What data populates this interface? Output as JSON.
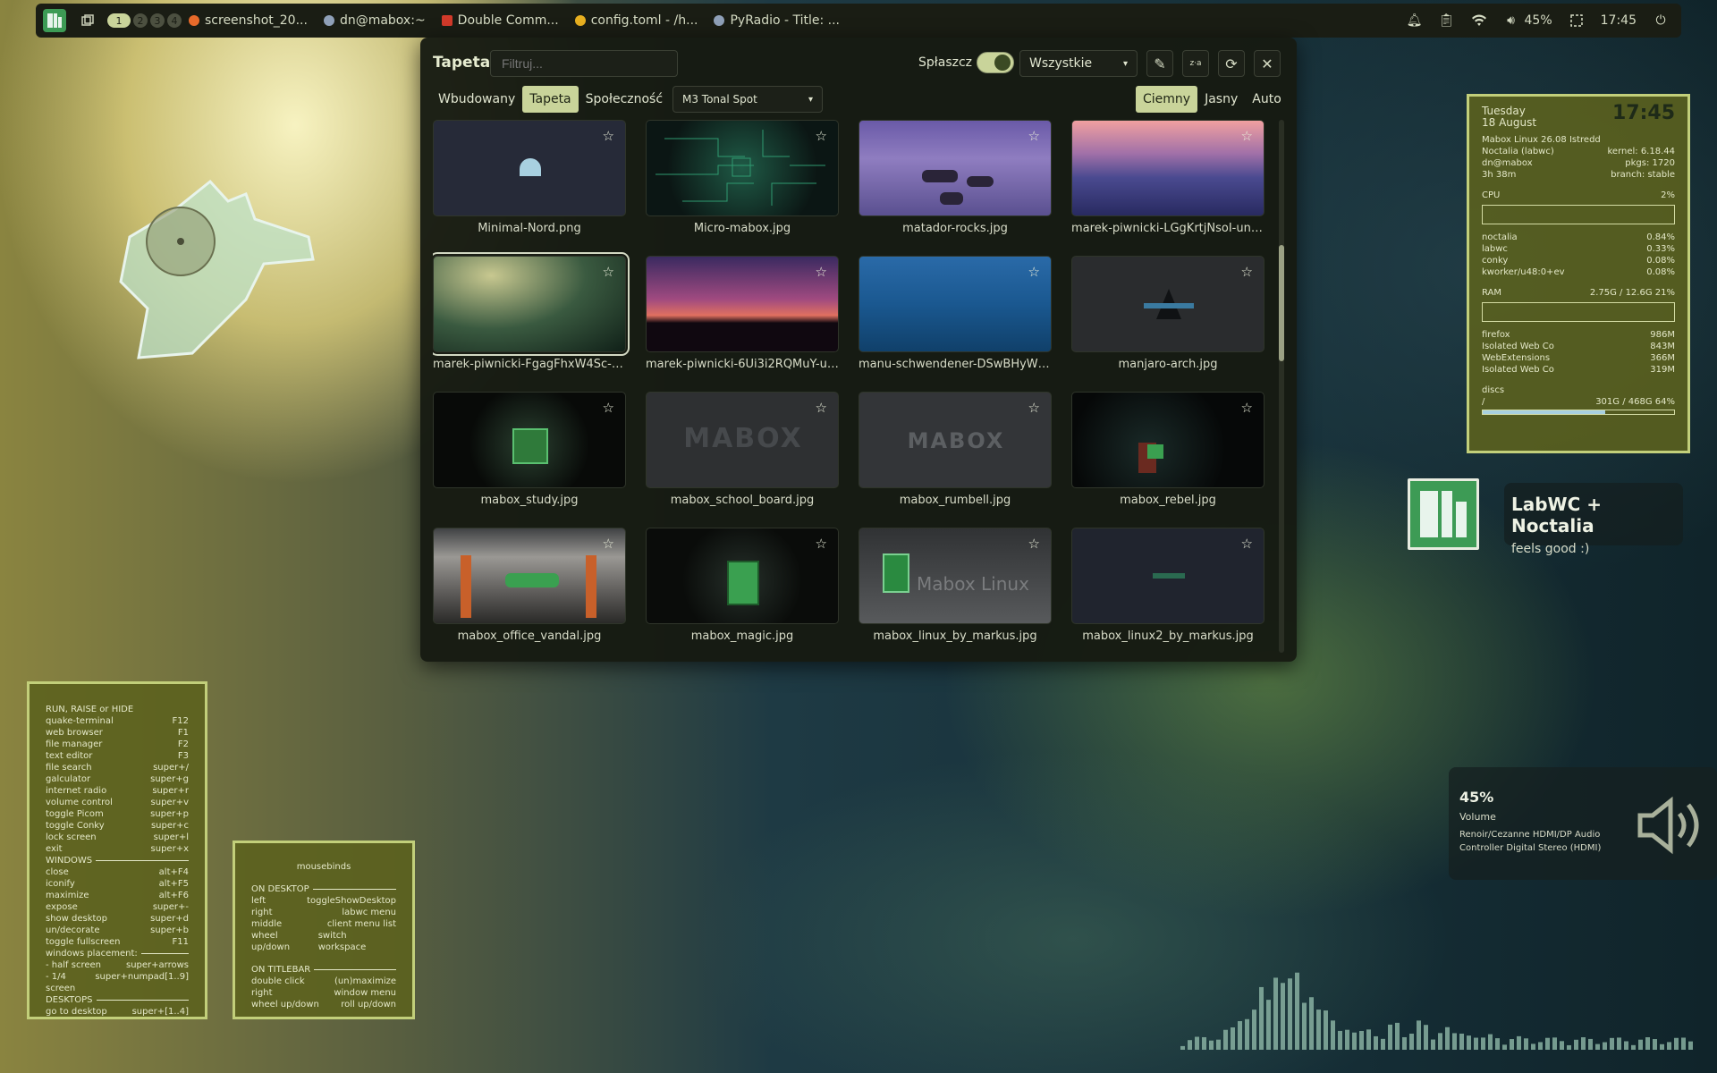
{
  "topbar": {
    "workspaces": [
      "1",
      "2",
      "3",
      "4"
    ],
    "tasks": [
      {
        "label": "screenshot_20...",
        "color": "#e86a2a",
        "icon": "firefox-icon"
      },
      {
        "label": "dn@mabox:~",
        "color": "#8fa0b8",
        "icon": "terminal-icon"
      },
      {
        "label": "Double Comm...",
        "color": "#d23a2a",
        "icon": "double-commander-icon"
      },
      {
        "label": "config.toml - /h...",
        "color": "#e8b020",
        "icon": "editor-icon"
      },
      {
        "label": "PyRadio - Title: ...",
        "color": "#8fa0b8",
        "icon": "radio-icon"
      }
    ],
    "volume": "45%",
    "time": "17:45"
  },
  "panel": {
    "title": "Tapeta",
    "filter_placeholder": "Filtruj...",
    "flatten_label": "Spłaszcz",
    "source_select": "Wszystkie",
    "tabs": [
      "Wbudowany",
      "Tapeta",
      "Społeczność"
    ],
    "active_tab": "Tapeta",
    "scheme_select": "M3 Tonal Spot",
    "modes": [
      "Ciemny",
      "Jasny",
      "Auto"
    ],
    "active_mode": "Ciemny",
    "items": [
      {
        "name": "Minimal-Nord.png"
      },
      {
        "name": "Micro-mabox.jpg"
      },
      {
        "name": "matador-rocks.jpg"
      },
      {
        "name": "marek-piwnicki-LGgKrtjNsoI-unspl..."
      },
      {
        "name": "marek-piwnicki-FgagFhxW4Sc-uns..."
      },
      {
        "name": "marek-piwnicki-6Ui3i2RQMuY-uns..."
      },
      {
        "name": "manu-schwendener-DSwBHyWKiV..."
      },
      {
        "name": "manjaro-arch.jpg"
      },
      {
        "name": "mabox_study.jpg"
      },
      {
        "name": "mabox_school_board.jpg"
      },
      {
        "name": "mabox_rumbell.jpg"
      },
      {
        "name": "mabox_rebel.jpg"
      },
      {
        "name": "mabox_office_vandal.jpg"
      },
      {
        "name": "mabox_magic.jpg"
      },
      {
        "name": "mabox_linux_by_markus.jpg"
      },
      {
        "name": "mabox_linux2_by_markus.jpg"
      }
    ],
    "thumb_texts": {
      "mabox": "MABOX",
      "linux": "Mabox Linux"
    }
  },
  "conky": {
    "day": "Tuesday",
    "date": "18 August",
    "time": "17:45",
    "os": "Mabox Linux 26.08 Istredd",
    "rows": [
      [
        "Noctalia (labwc)",
        "kernel: 6.18.44"
      ],
      [
        "dn@mabox",
        "pkgs: 1720"
      ],
      [
        "3h 38m",
        "branch: stable"
      ]
    ],
    "cpu_label": "CPU",
    "cpu": "2%",
    "procs": [
      [
        "noctalia",
        "0.84%"
      ],
      [
        "labwc",
        "0.33%"
      ],
      [
        "conky",
        "0.08%"
      ],
      [
        "kworker/u48:0+ev",
        "0.08%"
      ]
    ],
    "ram_label": "RAM",
    "ram": "2.75G / 12.6G 21%",
    "mem": [
      [
        "firefox",
        "986M"
      ],
      [
        "Isolated Web Co",
        "843M"
      ],
      [
        "WebExtensions",
        "366M"
      ],
      [
        "Isolated Web Co",
        "319M"
      ]
    ],
    "disc_label": "discs",
    "disc_mount": "/",
    "disc": "301G / 468G 64%"
  },
  "keys": {
    "rows": [
      [
        "RUN, RAISE or HIDE",
        ""
      ],
      [
        "quake-terminal",
        "F12"
      ],
      [
        "web browser",
        "F1"
      ],
      [
        "file manager",
        "F2"
      ],
      [
        "text editor",
        "F3"
      ],
      [
        "file search",
        "super+/"
      ],
      [
        "galculator",
        "super+g"
      ],
      [
        "internet radio",
        "super+r"
      ],
      [
        "volume control",
        "super+v"
      ],
      [
        "toggle Picom",
        "super+p"
      ],
      [
        "toggle Conky",
        "super+c"
      ],
      [
        "lock screen",
        "super+l"
      ],
      [
        "exit",
        "super+x"
      ],
      [
        "WINDOWS",
        ""
      ],
      [
        "close",
        "alt+F4"
      ],
      [
        "iconify",
        "alt+F5"
      ],
      [
        "maximize",
        "alt+F6"
      ],
      [
        "expose",
        "super+-"
      ],
      [
        "show desktop",
        "super+d"
      ],
      [
        "un/decorate",
        "super+b"
      ],
      [
        "toggle fullscreen",
        "F11"
      ],
      [
        "windows placement:",
        ""
      ],
      [
        "- half screen",
        "super+arrows"
      ],
      [
        "- 1/4 screen",
        "super+numpad[1..9]"
      ],
      [
        "DESKTOPS",
        ""
      ],
      [
        "go to desktop",
        "super+[1..4]"
      ]
    ]
  },
  "mouse": {
    "title": "mousebinds",
    "sec1": "ON DESKTOP",
    "rows1": [
      [
        "left",
        "toggleShowDesktop"
      ],
      [
        "right",
        "labwc menu"
      ],
      [
        "middle",
        "client menu list"
      ],
      [
        "wheel up/down",
        "switch workspace"
      ]
    ],
    "sec2": "ON TITLEBAR",
    "rows2": [
      [
        "double click",
        "(un)maximize"
      ],
      [
        "right",
        "window menu"
      ],
      [
        "wheel up/down",
        "roll up/down"
      ]
    ]
  },
  "brand": {
    "title": "LabWC + Noctalia",
    "subtitle": "feels good :)"
  },
  "volume_osd": {
    "percent": "45%",
    "label": "Volume",
    "device": "Renoir/Cezanne HDMI/DP Audio Controller Digital Stereo (HDMI)"
  },
  "colors": {
    "accent": "#c9d49a",
    "brand_green": "#3d9b55",
    "panel_bg": "#161a12",
    "note_bg": "#5c621e"
  }
}
